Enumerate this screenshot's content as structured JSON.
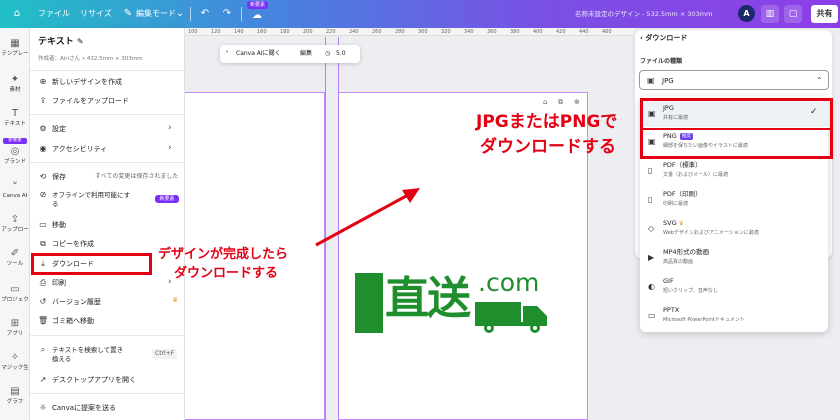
{
  "topbar": {
    "file": "ファイル",
    "resize": "リサイズ",
    "edit_mode": "編集モード",
    "new_badge": "新要素",
    "doc_title": "名称未設定のデザイン - 532.5mm × 303mm",
    "avatar": "A",
    "share": "共有"
  },
  "sidebar": {
    "items": [
      {
        "label": "テンプレー"
      },
      {
        "label": "素材"
      },
      {
        "label": "テキスト"
      },
      {
        "label": "ブランド"
      },
      {
        "label": "Canva AI"
      },
      {
        "label": "アップロー"
      },
      {
        "label": "ツール"
      },
      {
        "label": "プロジェク"
      },
      {
        "label": "アプリ"
      },
      {
        "label": "マジック生"
      },
      {
        "label": "グラフ"
      }
    ],
    "new_badge": "新要素"
  },
  "file_menu": {
    "title": "テキスト",
    "subtitle": "作成者：Airiさん • 432.5mm × 303mm",
    "items": {
      "new_design": "新しいデザインを作成",
      "upload": "ファイルをアップロード",
      "settings": "設定",
      "accessibility": "アクセシビリティ",
      "save": "保存",
      "save_note": "すべての変更は保存されました",
      "offline_1": "オフラインで利用可能にす",
      "offline_2": "る",
      "offline_badge": "新要素",
      "move": "移動",
      "copy": "コピーを作成",
      "download": "ダウンロード",
      "print": "印刷",
      "history": "バージョン履歴",
      "trash": "ゴミ箱へ移動",
      "search_1": "テキストを検索して置き",
      "search_2": "換える",
      "search_kbd": "Ctrl+F",
      "desktop": "デスクトップアプリを開く",
      "feedback": "Canvaに提案を送る"
    }
  },
  "canvas": {
    "ruler_ticks": [
      "100",
      "120",
      "140",
      "160",
      "180",
      "200",
      "220",
      "240",
      "260",
      "280",
      "300",
      "320",
      "340",
      "360",
      "380",
      "400",
      "420",
      "440",
      "460"
    ],
    "ctx_ai": "Canva AIに聞く",
    "ctx_edit": "編集",
    "ctx_time": "5.0",
    "logo_kanji": "直送",
    "logo_com": ".com"
  },
  "download_panel": {
    "back_label": "ダウンロード",
    "file_type_label": "ファイルの種類",
    "selected": "JPG",
    "options": [
      {
        "name": "JPG",
        "desc": "共有に最適"
      },
      {
        "name": "PNG",
        "desc": "細部を保ちたい画像やイラストに最適",
        "badge": "推奨"
      },
      {
        "name": "PDF（標準）",
        "desc": "文書（およびメール）に最適"
      },
      {
        "name": "PDF（印刷）",
        "desc": "印刷に最適"
      },
      {
        "name": "SVG",
        "desc": "Webデザインおよびアニメーションに最適"
      },
      {
        "name": "MP4形式の動画",
        "desc": "高品質の動画"
      },
      {
        "name": "GIF",
        "desc": "短いクリップ、音声なし"
      },
      {
        "name": "PPTX",
        "desc": "Microsoft PowerPointドキュメント"
      }
    ]
  },
  "annotations": {
    "left_1": "デザインが完成したら",
    "left_2": "ダウンロードする",
    "right_1": "JPGまたはPNGで",
    "right_2": "ダウンロードする",
    "color": "#e30012"
  },
  "colors": {
    "brand_green": "#1f8f2e",
    "accent_purple": "#7b2ff7",
    "annotation_red": "#e30012"
  }
}
